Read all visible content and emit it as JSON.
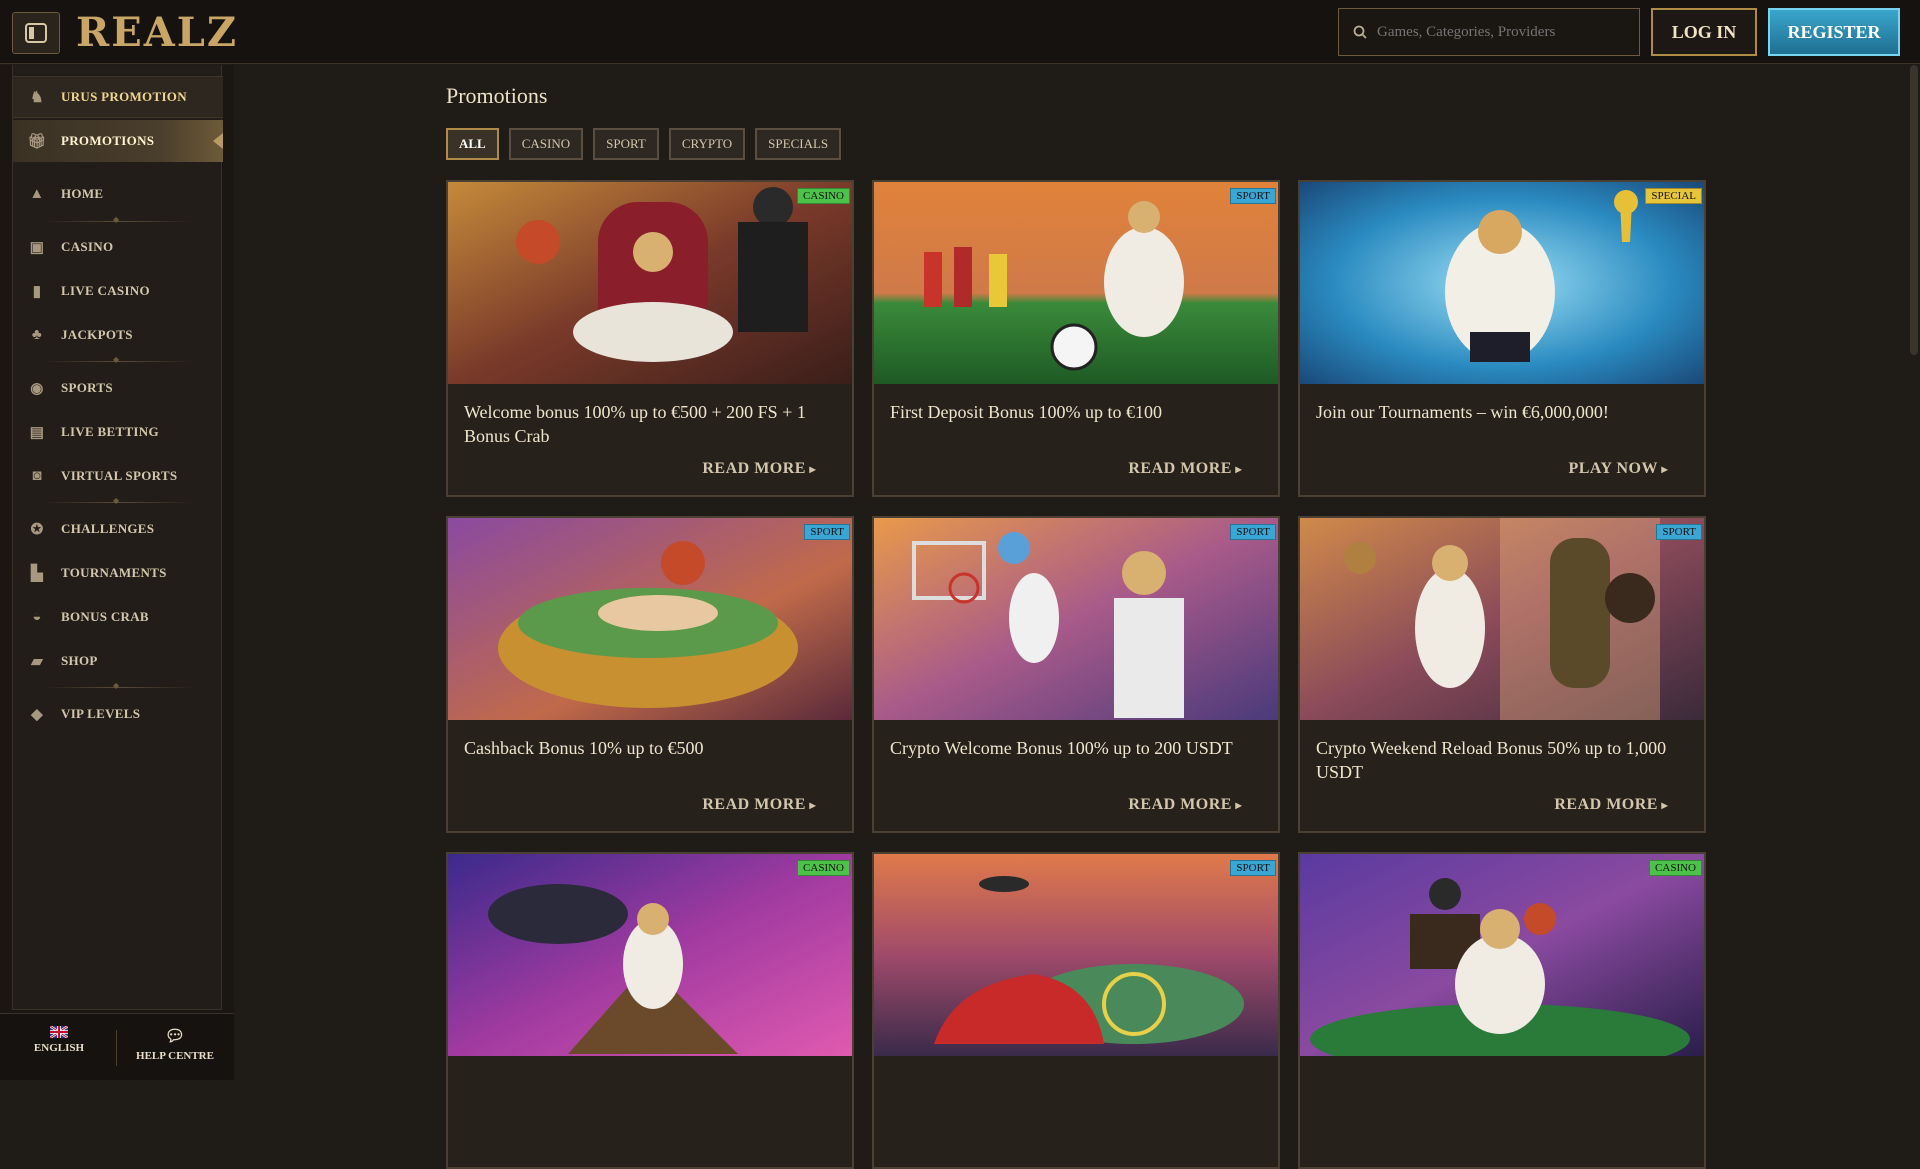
{
  "header": {
    "logo_text": "REALZ",
    "search_placeholder": "Games, Categories, Providers",
    "login_label": "LOG IN",
    "register_label": "REGISTER"
  },
  "sidebar": {
    "items": [
      {
        "label": "URUS PROMOTION",
        "icon": "urus-icon"
      },
      {
        "label": "PROMOTIONS",
        "icon": "gift-icon"
      },
      {
        "label": "HOME",
        "icon": "pyramid-icon"
      },
      {
        "label": "CASINO",
        "icon": "slot-machine-icon"
      },
      {
        "label": "LIVE CASINO",
        "icon": "card-icon"
      },
      {
        "label": "JACKPOTS",
        "icon": "clover-icon"
      },
      {
        "label": "SPORTS",
        "icon": "ball-icon"
      },
      {
        "label": "LIVE BETTING",
        "icon": "live-icon"
      },
      {
        "label": "VIRTUAL SPORTS",
        "icon": "vr-icon"
      },
      {
        "label": "CHALLENGES",
        "icon": "medal-icon"
      },
      {
        "label": "TOURNAMENTS",
        "icon": "podium-icon"
      },
      {
        "label": "BONUS CRAB",
        "icon": "crab-icon"
      },
      {
        "label": "SHOP",
        "icon": "bag-icon"
      },
      {
        "label": "VIP LEVELS",
        "icon": "diamond-icon"
      }
    ],
    "language_label": "ENGLISH",
    "help_label": "HELP CENTRE"
  },
  "main": {
    "title": "Promotions",
    "tabs": [
      "ALL",
      "CASINO",
      "SPORT",
      "CRYPTO",
      "SPECIALS"
    ],
    "active_tab": "ALL",
    "cards": [
      {
        "badge": "CASINO",
        "title": "Welcome bonus 100% up to €500 + 200 FS + 1 Bonus Crab",
        "cta": "READ MORE"
      },
      {
        "badge": "SPORT",
        "title": "First Deposit Bonus 100% up to €100",
        "cta": "READ MORE"
      },
      {
        "badge": "SPECIAL",
        "title": "Join our Tournaments – win €6,000,000!",
        "cta": "PLAY NOW"
      },
      {
        "badge": "SPORT",
        "title": "Cashback Bonus 10% up to €500",
        "cta": "READ MORE"
      },
      {
        "badge": "SPORT",
        "title": "Crypto Welcome Bonus 100% up to 200 USDT",
        "cta": "READ MORE"
      },
      {
        "badge": "SPORT",
        "title": "Crypto Weekend Reload Bonus 50% up to 1,000 USDT",
        "cta": "READ MORE"
      },
      {
        "badge": "CASINO",
        "title": "",
        "cta": ""
      },
      {
        "badge": "SPORT",
        "title": "",
        "cta": ""
      },
      {
        "badge": "CASINO",
        "title": "",
        "cta": ""
      }
    ]
  },
  "colors": {
    "accent_gold": "#b18a47",
    "register_blue": "#3aa6cb",
    "badge_casino": "#4cc24a",
    "badge_sport": "#3aa6d4",
    "badge_special": "#e6c53a"
  }
}
